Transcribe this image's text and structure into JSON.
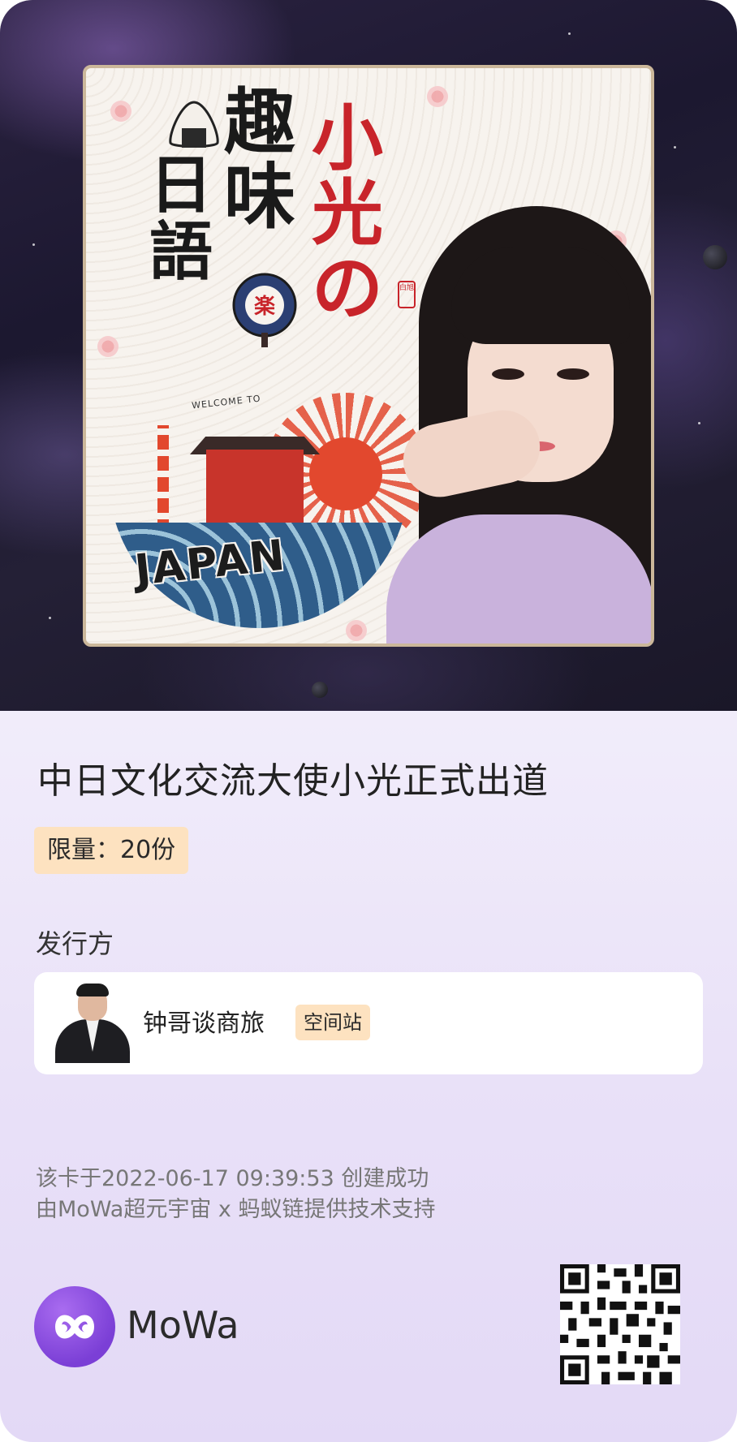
{
  "cover": {
    "title_chars_black": [
      "趣",
      "味"
    ],
    "title_chars_left": [
      "日",
      "語"
    ],
    "title_chars_red": [
      "小",
      "光",
      "の"
    ],
    "welcome_text": "WELCOME TO",
    "japan_text": "JAPAN",
    "seal_text": "白旭"
  },
  "nft": {
    "title": "中日文化交流大使小光正式出道",
    "limit_label": "限量：20份"
  },
  "issuer": {
    "section_label": "发行方",
    "name": "钟哥谈商旅",
    "badge": "空间站"
  },
  "footer": {
    "created_text": "该卡于2022-06-17 09:39:53 创建成功",
    "support_text": "由MoWa超元宇宙 x 蚂蚁链提供技术支持",
    "brand_name": "MoWa"
  },
  "colors": {
    "badge_bg": "#fde2c0",
    "brand_purple": "#7b3fd6",
    "accent_red": "#c8242a"
  }
}
